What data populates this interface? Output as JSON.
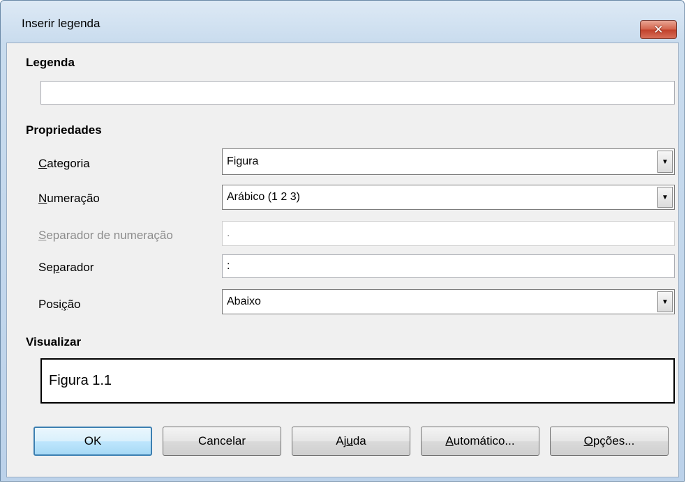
{
  "window": {
    "title": "Inserir legenda"
  },
  "caption": {
    "heading": "Legenda",
    "value": ""
  },
  "properties": {
    "heading": "Propriedades",
    "category": {
      "label": "Categoria",
      "value": "Figura"
    },
    "numbering": {
      "label": "Numeração",
      "value": "Arábico (1 2 3)"
    },
    "numbering_separator": {
      "label": "Separador de numeração",
      "value": "."
    },
    "separator": {
      "label": "Separador",
      "value": ":"
    },
    "position": {
      "label": "Posição",
      "value": "Abaixo"
    }
  },
  "preview": {
    "heading": "Visualizar",
    "text": "Figura 1.1"
  },
  "buttons": {
    "ok": "OK",
    "cancel": "Cancelar",
    "help": "Ajuda",
    "auto": "Automático...",
    "options": "Opções..."
  },
  "icons": {
    "close": "close-icon",
    "dropdown": "chevron-down-icon"
  }
}
